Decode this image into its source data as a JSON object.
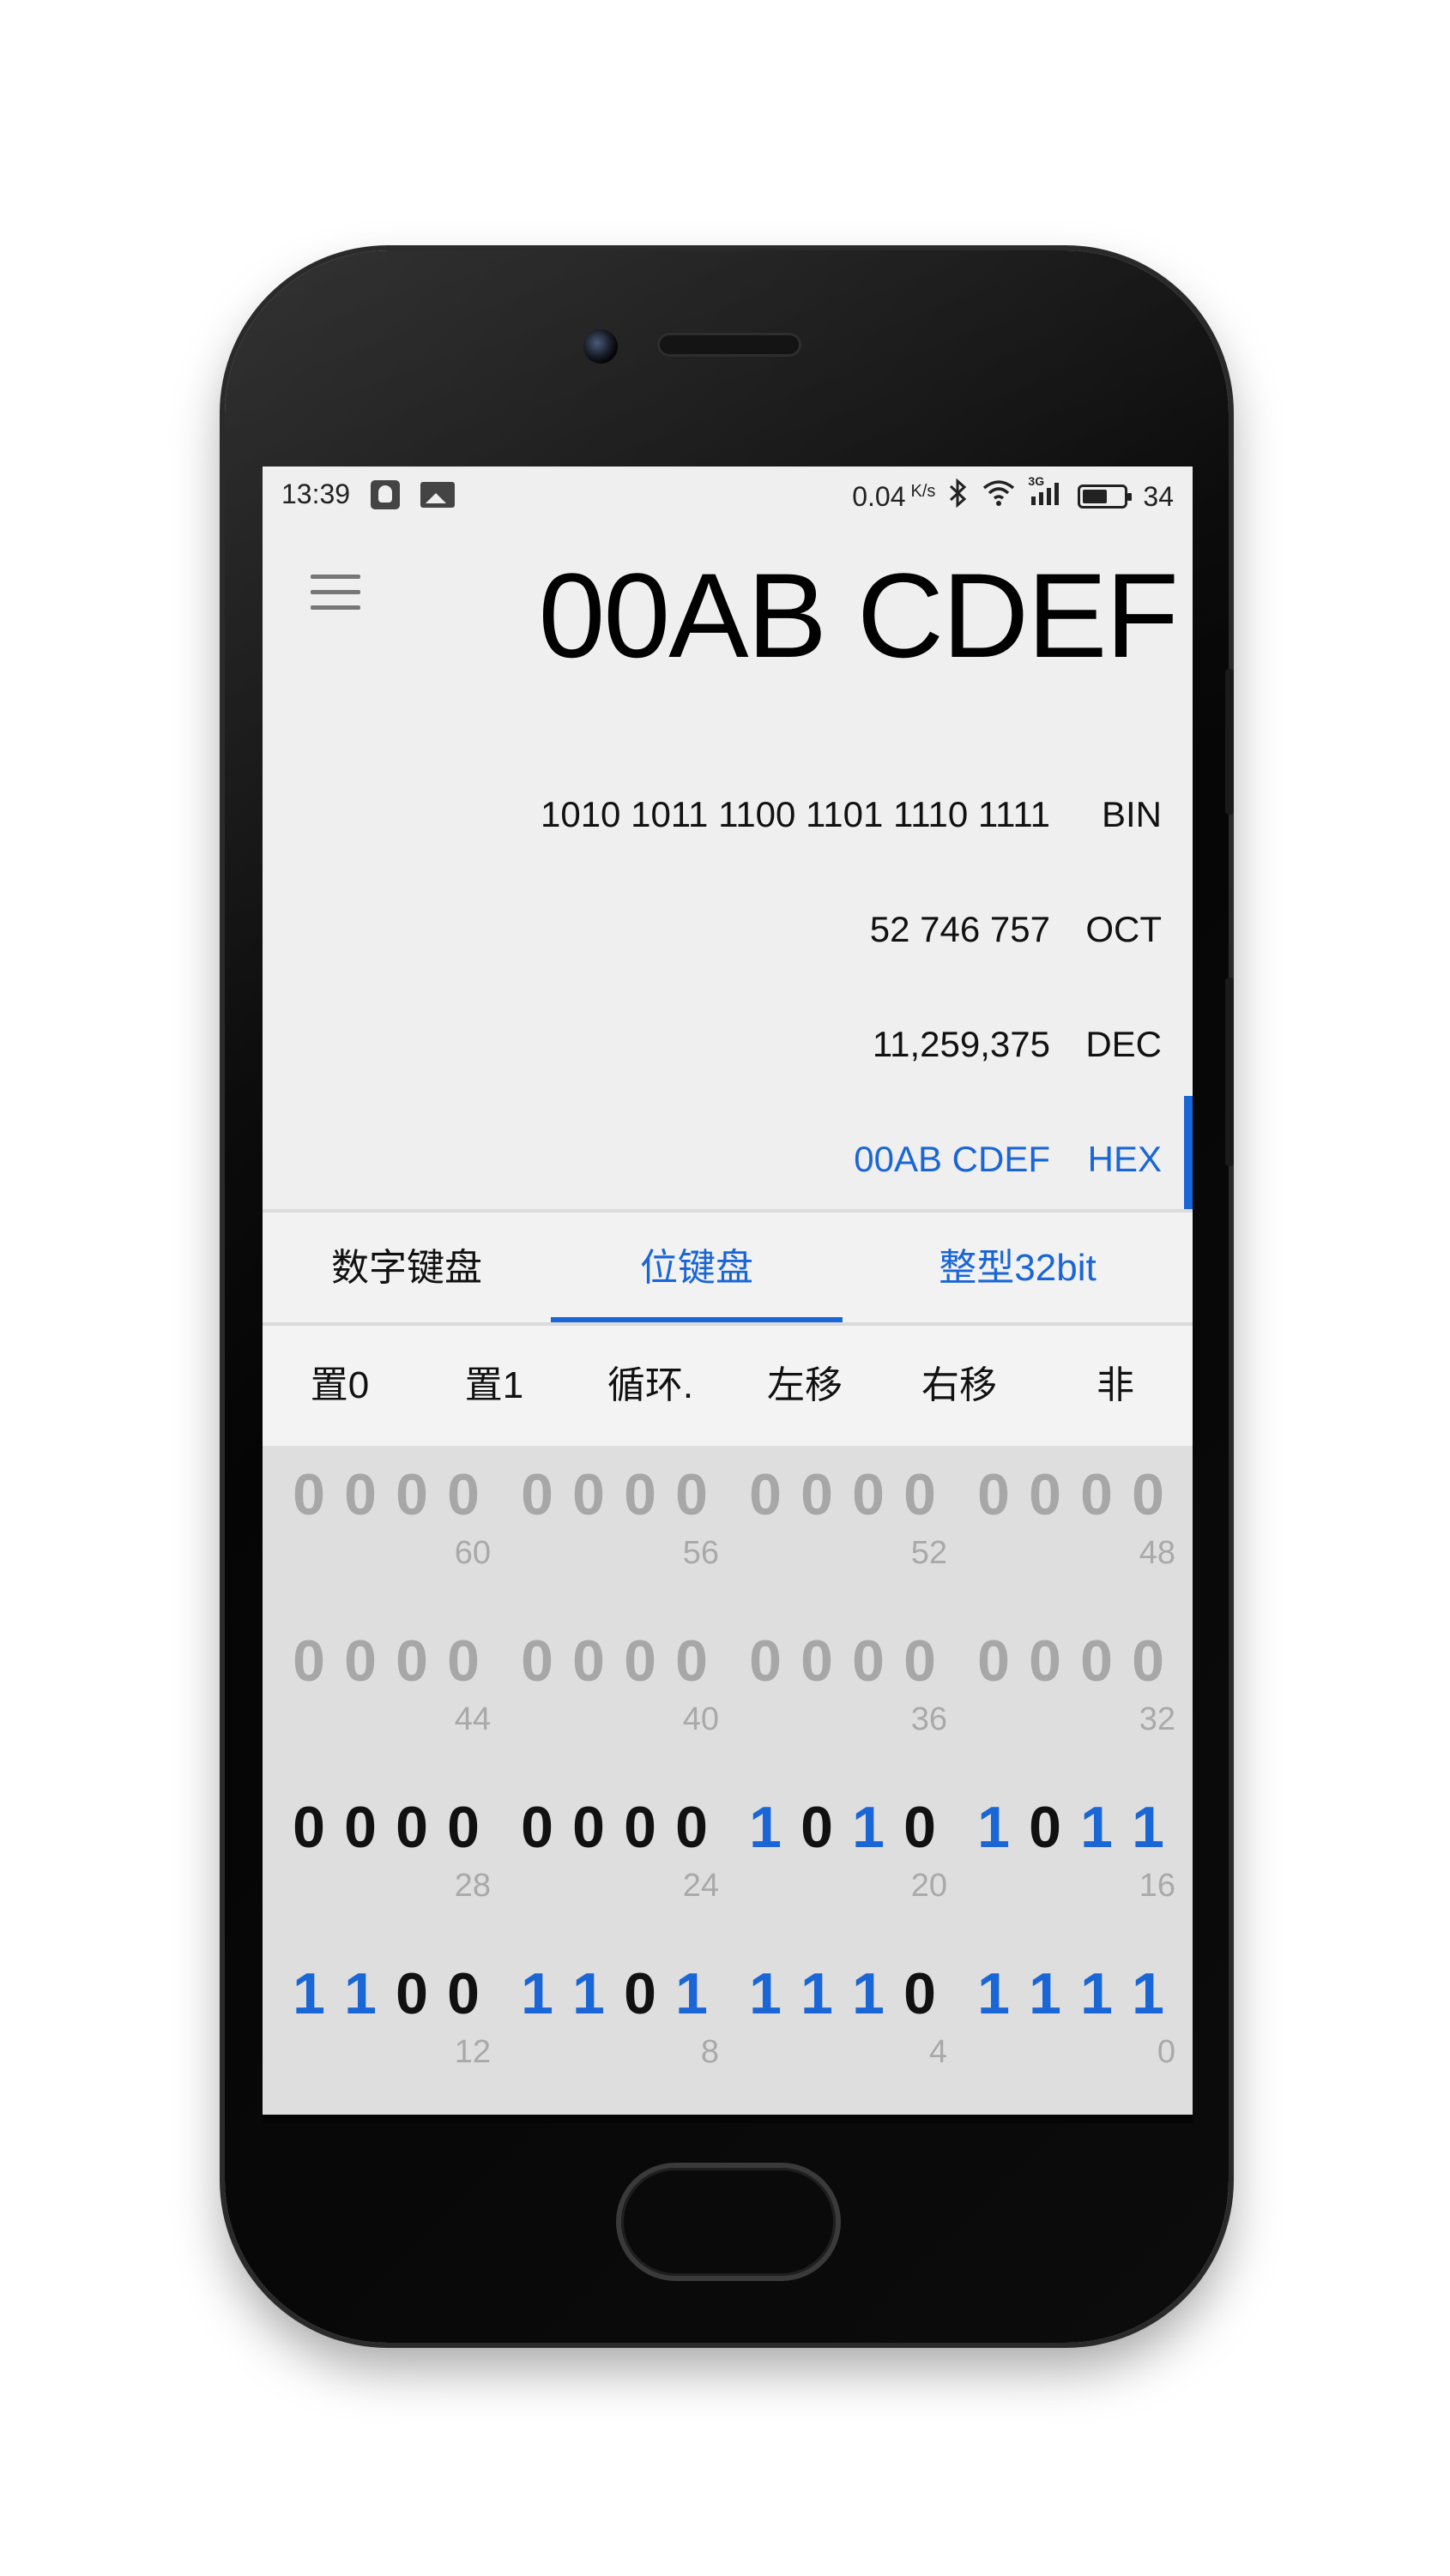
{
  "status_bar": {
    "time": "13:39",
    "network_speed": "0.04",
    "speed_unit": "K/s",
    "network_type": "3G",
    "battery_level": "34",
    "icons": [
      "qq-icon",
      "image-notification-icon",
      "bluetooth-icon",
      "wifi-icon",
      "cellular-signal-icon",
      "battery-icon"
    ]
  },
  "display": {
    "main_value": "00AB CDEF",
    "bases": [
      {
        "value": "1010 1011 1100 1101 1110 1111",
        "label": "BIN"
      },
      {
        "value": "52 746 757",
        "label": "OCT"
      },
      {
        "value": "11,259,375",
        "label": "DEC"
      },
      {
        "value": "00AB CDEF",
        "label": "HEX"
      }
    ],
    "active_base": "HEX"
  },
  "tabs": [
    {
      "label": "数字键盘"
    },
    {
      "label": "位键盘"
    },
    {
      "label": "整型32bit"
    }
  ],
  "selected_tab": "位键盘",
  "operations": [
    {
      "label": "置0"
    },
    {
      "label": "置1"
    },
    {
      "label": "循环."
    },
    {
      "label": "左移"
    },
    {
      "label": "右移"
    },
    {
      "label": "非"
    }
  ],
  "bit_keyboard": {
    "rows": [
      {
        "nibbles": [
          {
            "bits": [
              "0",
              "0",
              "0",
              "0"
            ],
            "position": "60",
            "enabled": false
          },
          {
            "bits": [
              "0",
              "0",
              "0",
              "0"
            ],
            "position": "56",
            "enabled": false
          },
          {
            "bits": [
              "0",
              "0",
              "0",
              "0"
            ],
            "position": "52",
            "enabled": false
          },
          {
            "bits": [
              "0",
              "0",
              "0",
              "0"
            ],
            "position": "48",
            "enabled": false
          }
        ]
      },
      {
        "nibbles": [
          {
            "bits": [
              "0",
              "0",
              "0",
              "0"
            ],
            "position": "44",
            "enabled": false
          },
          {
            "bits": [
              "0",
              "0",
              "0",
              "0"
            ],
            "position": "40",
            "enabled": false
          },
          {
            "bits": [
              "0",
              "0",
              "0",
              "0"
            ],
            "position": "36",
            "enabled": false
          },
          {
            "bits": [
              "0",
              "0",
              "0",
              "0"
            ],
            "position": "32",
            "enabled": false
          }
        ]
      },
      {
        "nibbles": [
          {
            "bits": [
              "0",
              "0",
              "0",
              "0"
            ],
            "position": "28",
            "enabled": true
          },
          {
            "bits": [
              "0",
              "0",
              "0",
              "0"
            ],
            "position": "24",
            "enabled": true
          },
          {
            "bits": [
              "1",
              "0",
              "1",
              "0"
            ],
            "position": "20",
            "enabled": true
          },
          {
            "bits": [
              "1",
              "0",
              "1",
              "1"
            ],
            "position": "16",
            "enabled": true
          }
        ]
      },
      {
        "nibbles": [
          {
            "bits": [
              "1",
              "1",
              "0",
              "0"
            ],
            "position": "12",
            "enabled": true
          },
          {
            "bits": [
              "1",
              "1",
              "0",
              "1"
            ],
            "position": "8",
            "enabled": true
          },
          {
            "bits": [
              "1",
              "1",
              "1",
              "0"
            ],
            "position": "4",
            "enabled": true
          },
          {
            "bits": [
              "1",
              "1",
              "1",
              "1"
            ],
            "position": "0",
            "enabled": true
          }
        ]
      }
    ]
  },
  "colors": {
    "accent": "#1a66d6",
    "bit_zero": "#111111",
    "bit_disabled": "#a7a7a7",
    "screen_background": "#efefef",
    "keyboard_background": "#dedede"
  }
}
